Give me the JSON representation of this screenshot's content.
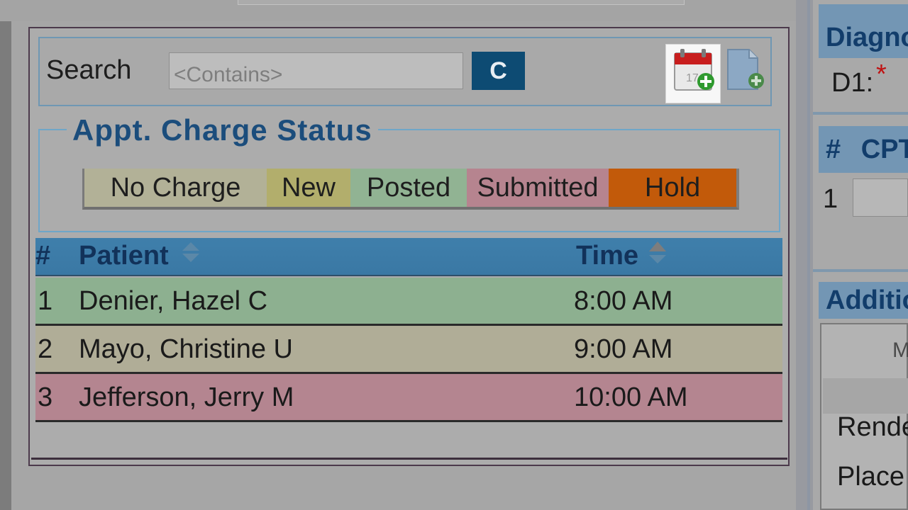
{
  "search": {
    "label": "Search",
    "placeholder": "<Contains>",
    "value": "",
    "clear_label": "C"
  },
  "toolbar": {
    "calendar_icon": "calendar-add-icon",
    "document_icon": "document-add-icon"
  },
  "status_legend": {
    "title": "Appt. Charge Status",
    "items": [
      {
        "label": "No Charge",
        "color": "#b2b197"
      },
      {
        "label": "New",
        "color": "#b2ae6c"
      },
      {
        "label": "Posted",
        "color": "#91b393"
      },
      {
        "label": "Submitted",
        "color": "#b6848f"
      },
      {
        "label": "Hold",
        "color": "#c25a0a"
      }
    ]
  },
  "appointments": {
    "columns": {
      "num": "#",
      "patient": "Patient",
      "time": "Time"
    },
    "sort": {
      "column": "Time",
      "direction": "ascending"
    },
    "rows": [
      {
        "num": "1",
        "patient": "Denier, Hazel C",
        "time": "8:00 AM",
        "status": "Posted"
      },
      {
        "num": "2",
        "patient": "Mayo, Christine U",
        "time": "9:00 AM",
        "status": "No Charge"
      },
      {
        "num": "3",
        "patient": "Jefferson, Jerry M",
        "time": "10:00 AM",
        "status": "Submitted"
      }
    ]
  },
  "right_panel": {
    "diagnosis_header": "Diagno",
    "d1_label": "D1:",
    "required_mark": "*",
    "cpt_col_num": "#",
    "cpt_col_label": "CPT",
    "cpt_row_num": "1",
    "additional_header": "Additio",
    "box_header_fragment": "M",
    "rendering_label": "Rende",
    "place_label": "Place"
  }
}
